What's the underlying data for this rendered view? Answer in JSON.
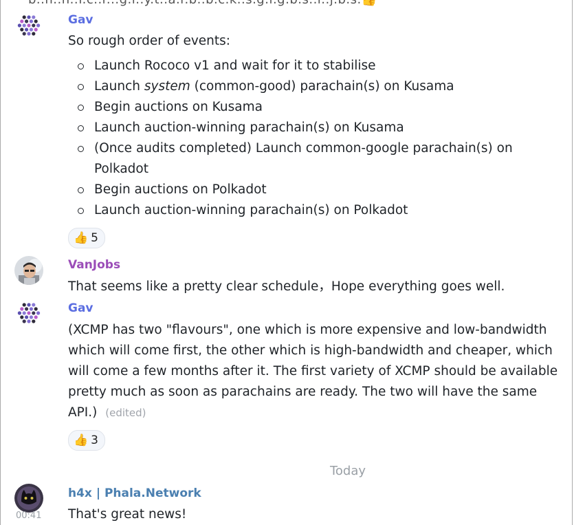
{
  "top_cut_text": "b..n..n..f.c..r...g.l..y.t..a.r.b..b.c.k..s.g.l.g.b.s..l..j.b.s.👍",
  "messages": [
    {
      "author": "Gav",
      "author_color": "#5b6ee1",
      "intro": "So rough order of events:",
      "list": [
        {
          "pre": "Launch Rococo v1 and wait for it to stabilise",
          "em": "",
          "post": ""
        },
        {
          "pre": "Launch ",
          "em": "system",
          "post": " (common-good) parachain(s) on Kusama"
        },
        {
          "pre": "Begin auctions on Kusama",
          "em": "",
          "post": ""
        },
        {
          "pre": "Launch auction-winning parachain(s) on Kusama",
          "em": "",
          "post": ""
        },
        {
          "pre": "(Once audits completed) Launch common-google parachain(s) on",
          "em": "",
          "post": ""
        },
        {
          "pre": "Polkadot",
          "em": "",
          "post": "",
          "continuation": true
        },
        {
          "pre": "Begin auctions on Polkadot",
          "em": "",
          "post": ""
        },
        {
          "pre": "Launch auction-winning parachain(s) on Polkadot",
          "em": "",
          "post": ""
        }
      ],
      "reaction": {
        "icon": "thumbs-up-icon",
        "emoji": "👍",
        "count": "5"
      }
    },
    {
      "author": "VanJobs",
      "author_color": "#9b4db8",
      "text": "That seems like a pretty clear schedule，Hope everything goes well."
    },
    {
      "author": "Gav",
      "author_color": "#5b6ee1",
      "lines": [
        "(XCMP has two \"flavours\", one which is more expensive and low-bandwidth",
        "which will come first, the other which is high-bandwidth and cheaper, which",
        "will come a few months after it. The first variety of XCMP should be available",
        "pretty much as soon as parachains are ready. The two will have the same",
        "API.)"
      ],
      "edited": "(edited)",
      "reaction": {
        "icon": "thumbs-up-icon",
        "emoji": "👍",
        "count": "3"
      }
    },
    {
      "author": "h4x | Phala.Network",
      "author_color": "#4a7fb0",
      "text": "That's great news!",
      "time": "00:41"
    }
  ],
  "divider": "Today"
}
